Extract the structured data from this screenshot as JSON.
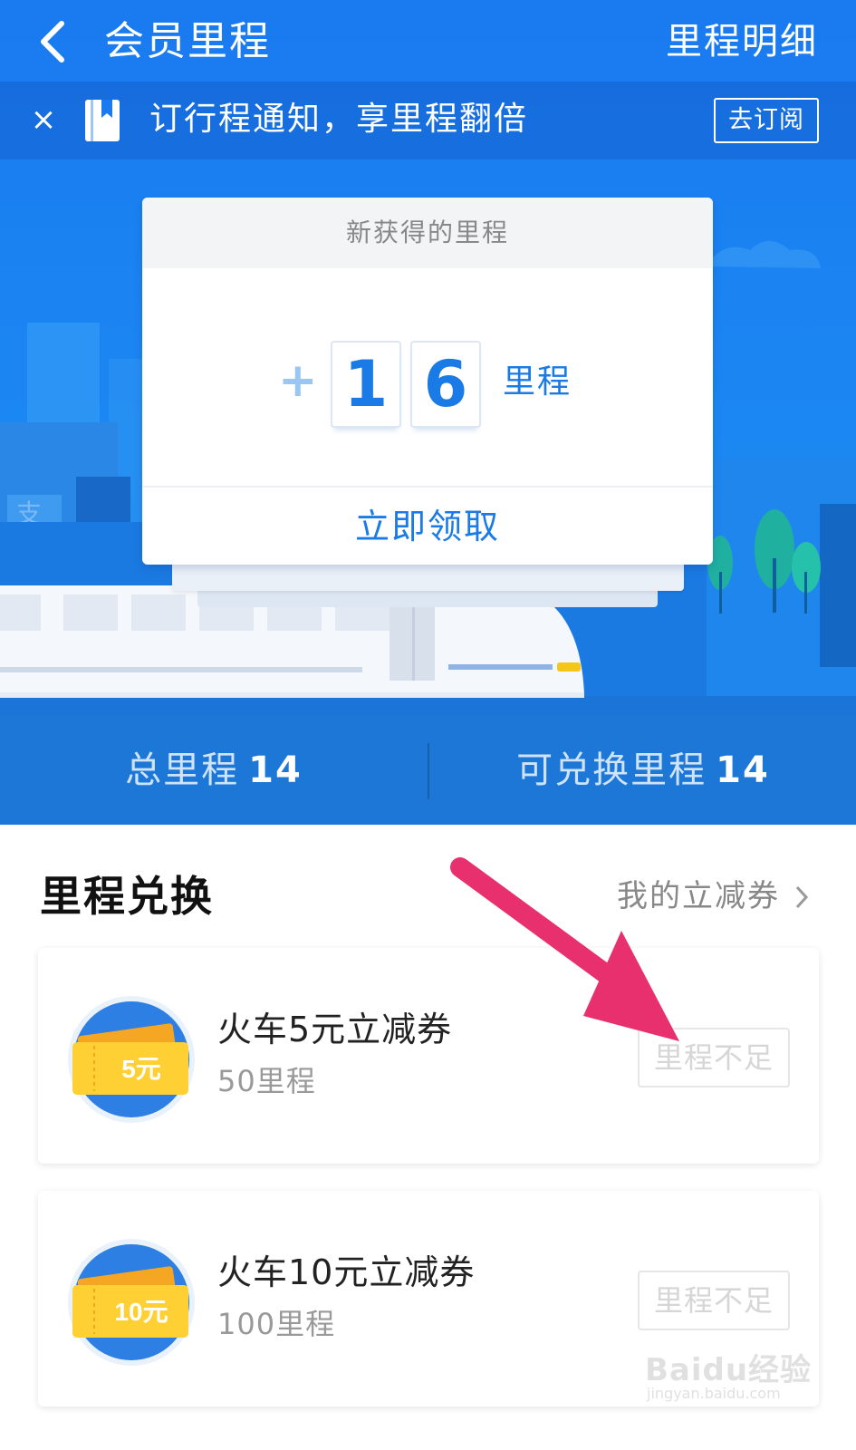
{
  "header": {
    "title": "会员里程",
    "detail_link": "里程明细"
  },
  "notice": {
    "close": "×",
    "text": "订行程通知，享里程翻倍",
    "subscribe_button": "去订阅"
  },
  "card": {
    "title": "新获得的里程",
    "plus": "+",
    "digits": [
      "1",
      "6"
    ],
    "unit": "里程",
    "claim_button": "立即领取"
  },
  "stats": {
    "total_label": "总里程",
    "total_value": "14",
    "exchangeable_label": "可兑换里程",
    "exchangeable_value": "14"
  },
  "exchange": {
    "title": "里程兑换",
    "my_coupons_link": "我的立减券",
    "items": [
      {
        "name": "火车5元立减券",
        "cost": "50里程",
        "badge": "5元",
        "button": "里程不足"
      },
      {
        "name": "火车10元立减券",
        "cost": "100里程",
        "badge": "10元",
        "button": "里程不足"
      }
    ]
  },
  "scene_sign": "支",
  "watermark": {
    "brand": "Baidu经验",
    "url": "jingyan.baidu.com"
  },
  "colors": {
    "primary": "#1b7be6",
    "header_blue": "#1a7af0",
    "stats_blue": "#1c77d6",
    "arrow": "#e8306f",
    "coupon_yellow": "#f7b928"
  },
  "icons": [
    "back-arrow-icon",
    "close-icon",
    "bookmark-icon",
    "chevron-right-icon",
    "ticket-icon"
  ]
}
